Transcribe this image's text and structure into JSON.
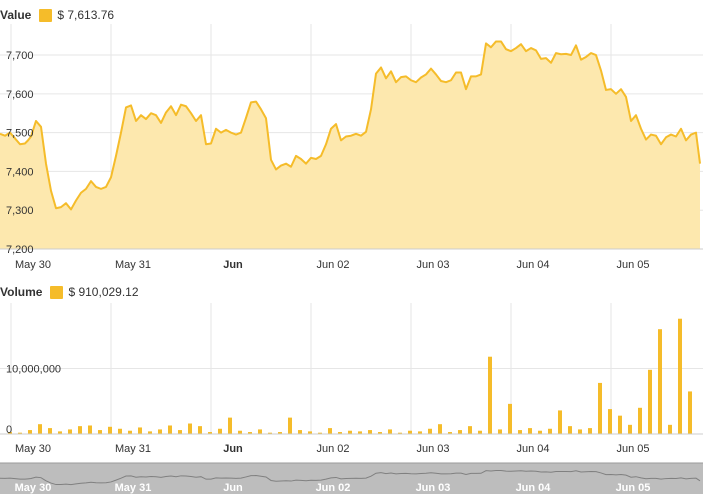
{
  "colors": {
    "accent": "#f5bc2a",
    "area_fill": "#fde8ae",
    "grid": "#e6e6e6",
    "navigator_fill": "#bdbdbd",
    "navigator_line": "#808080",
    "navigator_text": "#ffffff",
    "axis_text": "#333333"
  },
  "value_panel": {
    "title": "Value",
    "readout": "$ 7,613.76"
  },
  "volume_panel": {
    "title": "Volume",
    "readout": "$ 910,029.12"
  },
  "chart_data": [
    {
      "type": "area",
      "name": "value",
      "title": "Value",
      "x_ticks": [
        "May 30",
        "May 31",
        "Jun",
        "Jun 02",
        "Jun 03",
        "Jun 04",
        "Jun 05"
      ],
      "x_ticks_bold": [
        false,
        false,
        true,
        false,
        false,
        false,
        false
      ],
      "x_tick_pos": [
        0.25,
        1.25,
        2.25,
        3.25,
        4.25,
        5.25,
        6.25
      ],
      "y_ticks": [
        "7,200",
        "7,300",
        "7,400",
        "7,500",
        "7,600",
        "7,700"
      ],
      "y_tick_values": [
        7200,
        7300,
        7400,
        7500,
        7600,
        7700
      ],
      "xlim": [
        0,
        7.0
      ],
      "ylim": [
        7200,
        7780
      ],
      "grid": true,
      "x": [
        0.0,
        0.05,
        0.1,
        0.15,
        0.2,
        0.25,
        0.28,
        0.31,
        0.36,
        0.41,
        0.46,
        0.51,
        0.56,
        0.61,
        0.66,
        0.71,
        0.76,
        0.81,
        0.86,
        0.91,
        0.96,
        1.01,
        1.06,
        1.11,
        1.16,
        1.21,
        1.26,
        1.31,
        1.36,
        1.41,
        1.46,
        1.51,
        1.56,
        1.61,
        1.66,
        1.71,
        1.76,
        1.81,
        1.86,
        1.91,
        1.96,
        2.01,
        2.06,
        2.11,
        2.16,
        2.21,
        2.26,
        2.31,
        2.36,
        2.41,
        2.46,
        2.51,
        2.56,
        2.61,
        2.66,
        2.71,
        2.76,
        2.81,
        2.86,
        2.91,
        2.96,
        3.01,
        3.06,
        3.11,
        3.16,
        3.21,
        3.26,
        3.31,
        3.36,
        3.41,
        3.46,
        3.51,
        3.56,
        3.61,
        3.66,
        3.71,
        3.76,
        3.81,
        3.86,
        3.91,
        3.96,
        4.01,
        4.06,
        4.11,
        4.16,
        4.21,
        4.26,
        4.31,
        4.36,
        4.41,
        4.46,
        4.51,
        4.56,
        4.61,
        4.66,
        4.71,
        4.76,
        4.81,
        4.86,
        4.91,
        4.96,
        5.01,
        5.06,
        5.11,
        5.16,
        5.21,
        5.26,
        5.31,
        5.36,
        5.41,
        5.46,
        5.51,
        5.56,
        5.61,
        5.66,
        5.71,
        5.76,
        5.81,
        5.86,
        5.91,
        5.96,
        6.01,
        6.06,
        6.11,
        6.16,
        6.21,
        6.26,
        6.31,
        6.36,
        6.41,
        6.46,
        6.51,
        6.56,
        6.61,
        6.66,
        6.71,
        6.76,
        6.81,
        6.86,
        6.91,
        6.96,
        7.0
      ],
      "y": [
        7497,
        7492,
        7500,
        7485,
        7470,
        7472,
        7480,
        7490,
        7530,
        7515,
        7420,
        7350,
        7305,
        7308,
        7318,
        7302,
        7325,
        7345,
        7355,
        7375,
        7360,
        7355,
        7360,
        7385,
        7440,
        7500,
        7565,
        7570,
        7530,
        7545,
        7535,
        7550,
        7545,
        7525,
        7552,
        7568,
        7545,
        7572,
        7568,
        7550,
        7530,
        7545,
        7470,
        7472,
        7510,
        7500,
        7507,
        7500,
        7495,
        7500,
        7538,
        7578,
        7580,
        7560,
        7537,
        7430,
        7405,
        7415,
        7420,
        7412,
        7440,
        7432,
        7420,
        7435,
        7432,
        7440,
        7470,
        7510,
        7522,
        7480,
        7490,
        7492,
        7497,
        7492,
        7502,
        7560,
        7652,
        7668,
        7640,
        7658,
        7630,
        7643,
        7645,
        7635,
        7630,
        7642,
        7650,
        7665,
        7650,
        7633,
        7630,
        7635,
        7655,
        7655,
        7612,
        7645,
        7645,
        7650,
        7730,
        7720,
        7735,
        7735,
        7715,
        7710,
        7718,
        7728,
        7710,
        7718,
        7712,
        7690,
        7692,
        7680,
        7705,
        7702,
        7703,
        7700,
        7725,
        7688,
        7695,
        7705,
        7700,
        7660,
        7610,
        7612,
        7600,
        7612,
        7592,
        7530,
        7545,
        7510,
        7482,
        7495,
        7492,
        7470,
        7488,
        7495,
        7490,
        7510,
        7480,
        7495,
        7500,
        7420,
        7410,
        7410,
        7420,
        7450,
        7425,
        7480,
        7475,
        7418,
        7432,
        7425,
        7458,
        7422,
        7480,
        7585,
        7620,
        7655,
        7640,
        7610,
        7585,
        7598,
        7615,
        7622,
        7615,
        7613
      ]
    },
    {
      "type": "bar",
      "name": "volume",
      "title": "Volume",
      "x_ticks": [
        "May 30",
        "May 31",
        "Jun",
        "Jun 02",
        "Jun 03",
        "Jun 04",
        "Jun 05"
      ],
      "x_ticks_bold": [
        false,
        false,
        true,
        false,
        false,
        false,
        false
      ],
      "x_tick_pos": [
        0.25,
        1.25,
        2.25,
        3.25,
        4.25,
        5.25,
        6.25
      ],
      "y_ticks": [
        "0",
        "10,000,000"
      ],
      "y_tick_values": [
        0,
        10000000
      ],
      "xlim": [
        0,
        7.0
      ],
      "ylim": [
        0,
        20000000
      ],
      "grid": true,
      "x": [
        0.1,
        0.2,
        0.3,
        0.4,
        0.5,
        0.6,
        0.7,
        0.8,
        0.9,
        1.0,
        1.1,
        1.2,
        1.3,
        1.4,
        1.5,
        1.6,
        1.7,
        1.8,
        1.9,
        2.0,
        2.1,
        2.2,
        2.3,
        2.4,
        2.5,
        2.6,
        2.7,
        2.8,
        2.9,
        3.0,
        3.1,
        3.2,
        3.3,
        3.4,
        3.5,
        3.6,
        3.7,
        3.8,
        3.9,
        4.0,
        4.1,
        4.2,
        4.3,
        4.4,
        4.5,
        4.6,
        4.7,
        4.8,
        4.9,
        5.0,
        5.1,
        5.2,
        5.3,
        5.4,
        5.5,
        5.6,
        5.7,
        5.8,
        5.9,
        6.0,
        6.1,
        6.2,
        6.3,
        6.4,
        6.5,
        6.6,
        6.7,
        6.8,
        6.9
      ],
      "values": [
        300000,
        200000,
        600000,
        1500000,
        900000,
        400000,
        700000,
        1200000,
        1300000,
        600000,
        1100000,
        800000,
        500000,
        1000000,
        400000,
        700000,
        1300000,
        600000,
        1600000,
        1200000,
        300000,
        800000,
        2500000,
        500000,
        300000,
        700000,
        200000,
        300000,
        2500000,
        600000,
        400000,
        200000,
        900000,
        300000,
        500000,
        400000,
        600000,
        300000,
        700000,
        200000,
        500000,
        400000,
        800000,
        1500000,
        300000,
        600000,
        1200000,
        500000,
        11800000,
        700000,
        4600000,
        600000,
        900000,
        500000,
        800000,
        3600000,
        1200000,
        700000,
        900000,
        7800000,
        3800000,
        2800000,
        1400000,
        4000000,
        9800000,
        16000000,
        1400000,
        17600000,
        6500000
      ]
    }
  ],
  "navigator": {
    "labels": [
      "May 30",
      "May 31",
      "Jun",
      "Jun 02",
      "Jun 03",
      "Jun 04",
      "Jun 05"
    ]
  }
}
